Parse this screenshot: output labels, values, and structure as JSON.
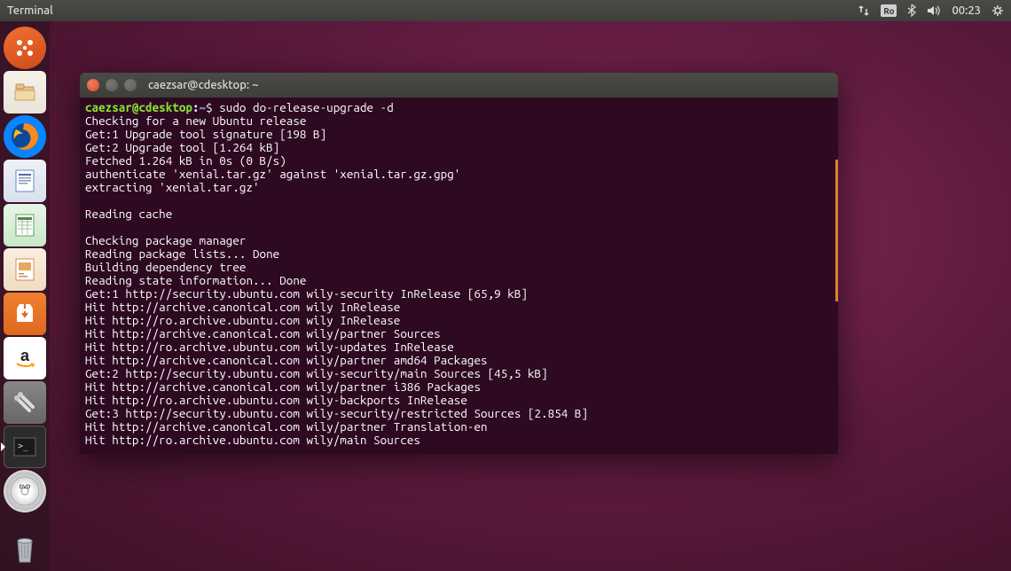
{
  "top_panel": {
    "title": "Terminal",
    "lang": "Ro",
    "time": "00:23"
  },
  "launcher": {
    "items": [
      {
        "name": "dash",
        "label": "Dash"
      },
      {
        "name": "files",
        "label": "Files"
      },
      {
        "name": "firefox",
        "label": "Firefox"
      },
      {
        "name": "writer",
        "label": "LibreOffice Writer"
      },
      {
        "name": "calc",
        "label": "LibreOffice Calc"
      },
      {
        "name": "impress",
        "label": "LibreOffice Impress"
      },
      {
        "name": "software",
        "label": "Ubuntu Software"
      },
      {
        "name": "amazon",
        "label": "Amazon"
      },
      {
        "name": "settings",
        "label": "System Settings"
      },
      {
        "name": "terminal",
        "label": "Terminal",
        "active": true
      },
      {
        "name": "dvd",
        "label": "DVD"
      },
      {
        "name": "trash",
        "label": "Trash"
      }
    ]
  },
  "terminal": {
    "title": "caezsar@cdesktop: ~",
    "prompt": {
      "user_host": "caezsar@cdesktop",
      "path": "~",
      "symbol": "$"
    },
    "command": "sudo do-release-upgrade -d",
    "output": [
      "Checking for a new Ubuntu release",
      "Get:1 Upgrade tool signature [198 B]",
      "Get:2 Upgrade tool [1.264 kB]",
      "Fetched 1.264 kB in 0s (0 B/s)",
      "authenticate 'xenial.tar.gz' against 'xenial.tar.gz.gpg'",
      "extracting 'xenial.tar.gz'",
      "",
      "Reading cache",
      "",
      "Checking package manager",
      "Reading package lists... Done",
      "Building dependency tree",
      "Reading state information... Done",
      "Get:1 http://security.ubuntu.com wily-security InRelease [65,9 kB]",
      "Hit http://archive.canonical.com wily InRelease",
      "Hit http://ro.archive.ubuntu.com wily InRelease",
      "Hit http://archive.canonical.com wily/partner Sources",
      "Hit http://ro.archive.ubuntu.com wily-updates InRelease",
      "Hit http://archive.canonical.com wily/partner amd64 Packages",
      "Get:2 http://security.ubuntu.com wily-security/main Sources [45,5 kB]",
      "Hit http://archive.canonical.com wily/partner i386 Packages",
      "Hit http://ro.archive.ubuntu.com wily-backports InRelease",
      "Get:3 http://security.ubuntu.com wily-security/restricted Sources [2.854 B]",
      "Hit http://archive.canonical.com wily/partner Translation-en",
      "Hit http://ro.archive.ubuntu.com wily/main Sources"
    ]
  }
}
